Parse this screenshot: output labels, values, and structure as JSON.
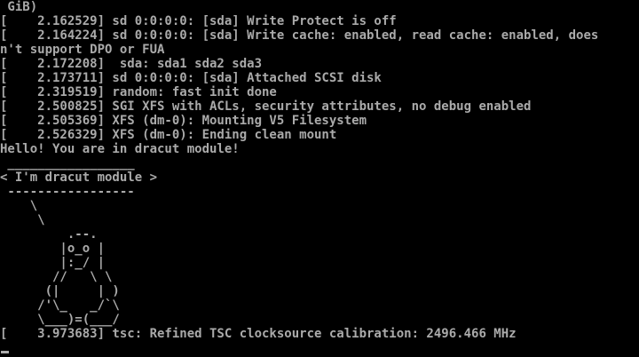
{
  "console": {
    "lines": [
      " GiB)",
      "[    2.162529] sd 0:0:0:0: [sda] Write Protect is off",
      "[    2.164224] sd 0:0:0:0: [sda] Write cache: enabled, read cache: enabled, does",
      "n't support DPO or FUA",
      "[    2.172208]  sda: sda1 sda2 sda3",
      "[    2.173711] sd 0:0:0:0: [sda] Attached SCSI disk",
      "[    2.319519] random: fast init done",
      "[    2.500825] SGI XFS with ACLs, security attributes, no debug enabled",
      "[    2.505369] XFS (dm-0): Mounting V5 Filesystem",
      "[    2.526329] XFS (dm-0): Ending clean mount",
      "Hello! You are in dracut module!",
      " _________________",
      "< I'm dracut module >",
      " -----------------",
      "    \\",
      "     \\",
      "         .--.",
      "        |o_o |",
      "        |:_/ |",
      "       //   \\ \\",
      "      (|     | )",
      "     /'\\_   _/`\\",
      "     \\___)=(___/",
      "[    3.973683] tsc: Refined TSC clocksource calibration: 2496.466 MHz"
    ],
    "cursor": "_"
  }
}
